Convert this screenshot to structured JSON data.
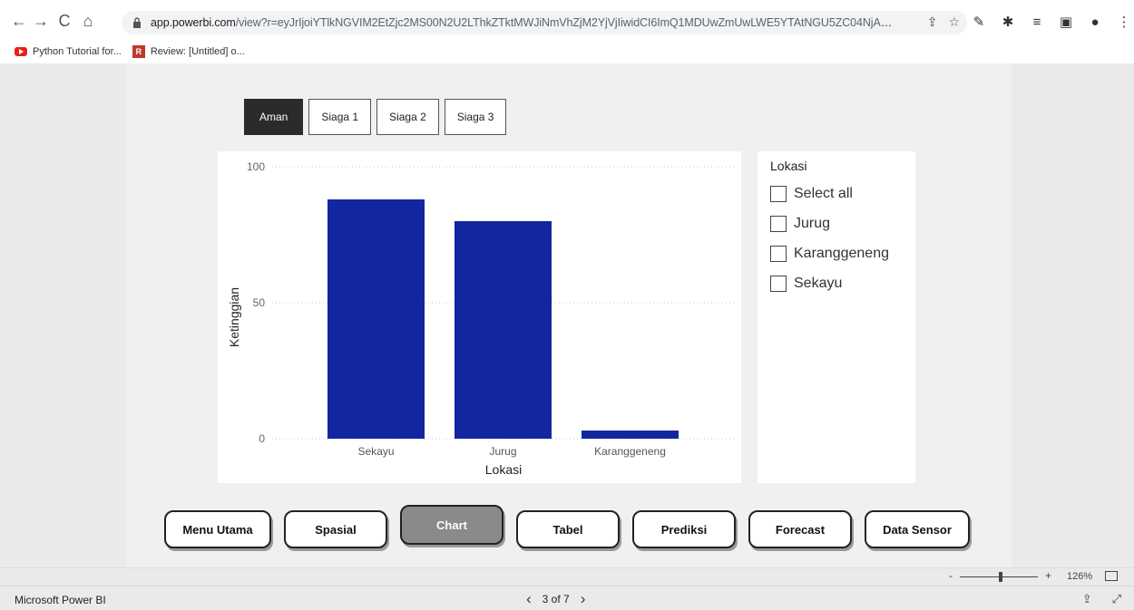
{
  "browser": {
    "url_host": "app.powerbi.com",
    "url_path": "/view?r=eyJrIjoiYTlkNGVIM2EtZjc2MS00N2U2LThkZTktMWJiNmVhZjM2YjVjIiwidCI6ImQ1MDUwZmUwLWE5YTAtNGU5ZC04NjA4L...",
    "bookmarks": [
      {
        "label": "Python Tutorial for..."
      },
      {
        "label": "Review: [Untitled] o..."
      }
    ]
  },
  "tabs": [
    {
      "label": "Aman",
      "active": true
    },
    {
      "label": "Siaga 1",
      "active": false
    },
    {
      "label": "Siaga 2",
      "active": false
    },
    {
      "label": "Siaga 3",
      "active": false
    }
  ],
  "slicer": {
    "title": "Lokasi",
    "items": [
      "Select all",
      "Jurug",
      "Karanggeneng",
      "Sekayu"
    ]
  },
  "nav_buttons": [
    {
      "label": "Menu Utama",
      "active": false
    },
    {
      "label": "Spasial",
      "active": false
    },
    {
      "label": "Chart",
      "active": true
    },
    {
      "label": "Tabel",
      "active": false
    },
    {
      "label": "Prediksi",
      "active": false
    },
    {
      "label": "Forecast",
      "active": false
    },
    {
      "label": "Data Sensor",
      "active": false
    }
  ],
  "zoom": {
    "level": "126%"
  },
  "footer": {
    "brand": "Microsoft Power BI",
    "page": "3 of 7"
  },
  "colors": {
    "bar": "#1226a0",
    "active_tab": "#2b2b2b",
    "active_nav": "#8a8a8a"
  },
  "chart_data": {
    "type": "bar",
    "categories": [
      "Sekayu",
      "Jurug",
      "Karanggeneng"
    ],
    "values": [
      88,
      80,
      3
    ],
    "xlabel": "Lokasi",
    "ylabel": "Ketinggian",
    "yticks": [
      0,
      50,
      100
    ],
    "ylim": [
      0,
      100
    ],
    "grid": true
  }
}
